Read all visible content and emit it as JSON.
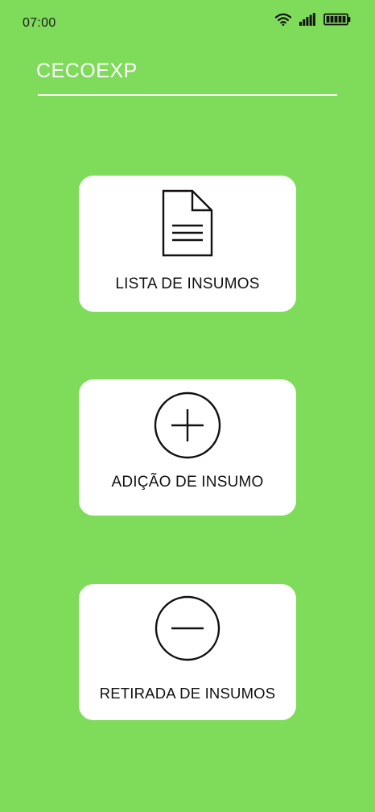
{
  "status_bar": {
    "time": "07:00",
    "icons": [
      "wifi-icon",
      "signal-icon",
      "battery-icon"
    ]
  },
  "app": {
    "title": "CECOEXP"
  },
  "menu": [
    {
      "label": "LISTA DE INSUMOS",
      "icon": "document-icon"
    },
    {
      "label": "ADIÇÃO DE INSUMO",
      "icon": "plus-circle-icon"
    },
    {
      "label": "RETIRADA DE INSUMOS",
      "icon": "minus-circle-icon"
    }
  ],
  "colors": {
    "background": "#7fdb5a",
    "card": "#ffffff",
    "text": "#111111",
    "title": "#ffffff"
  }
}
